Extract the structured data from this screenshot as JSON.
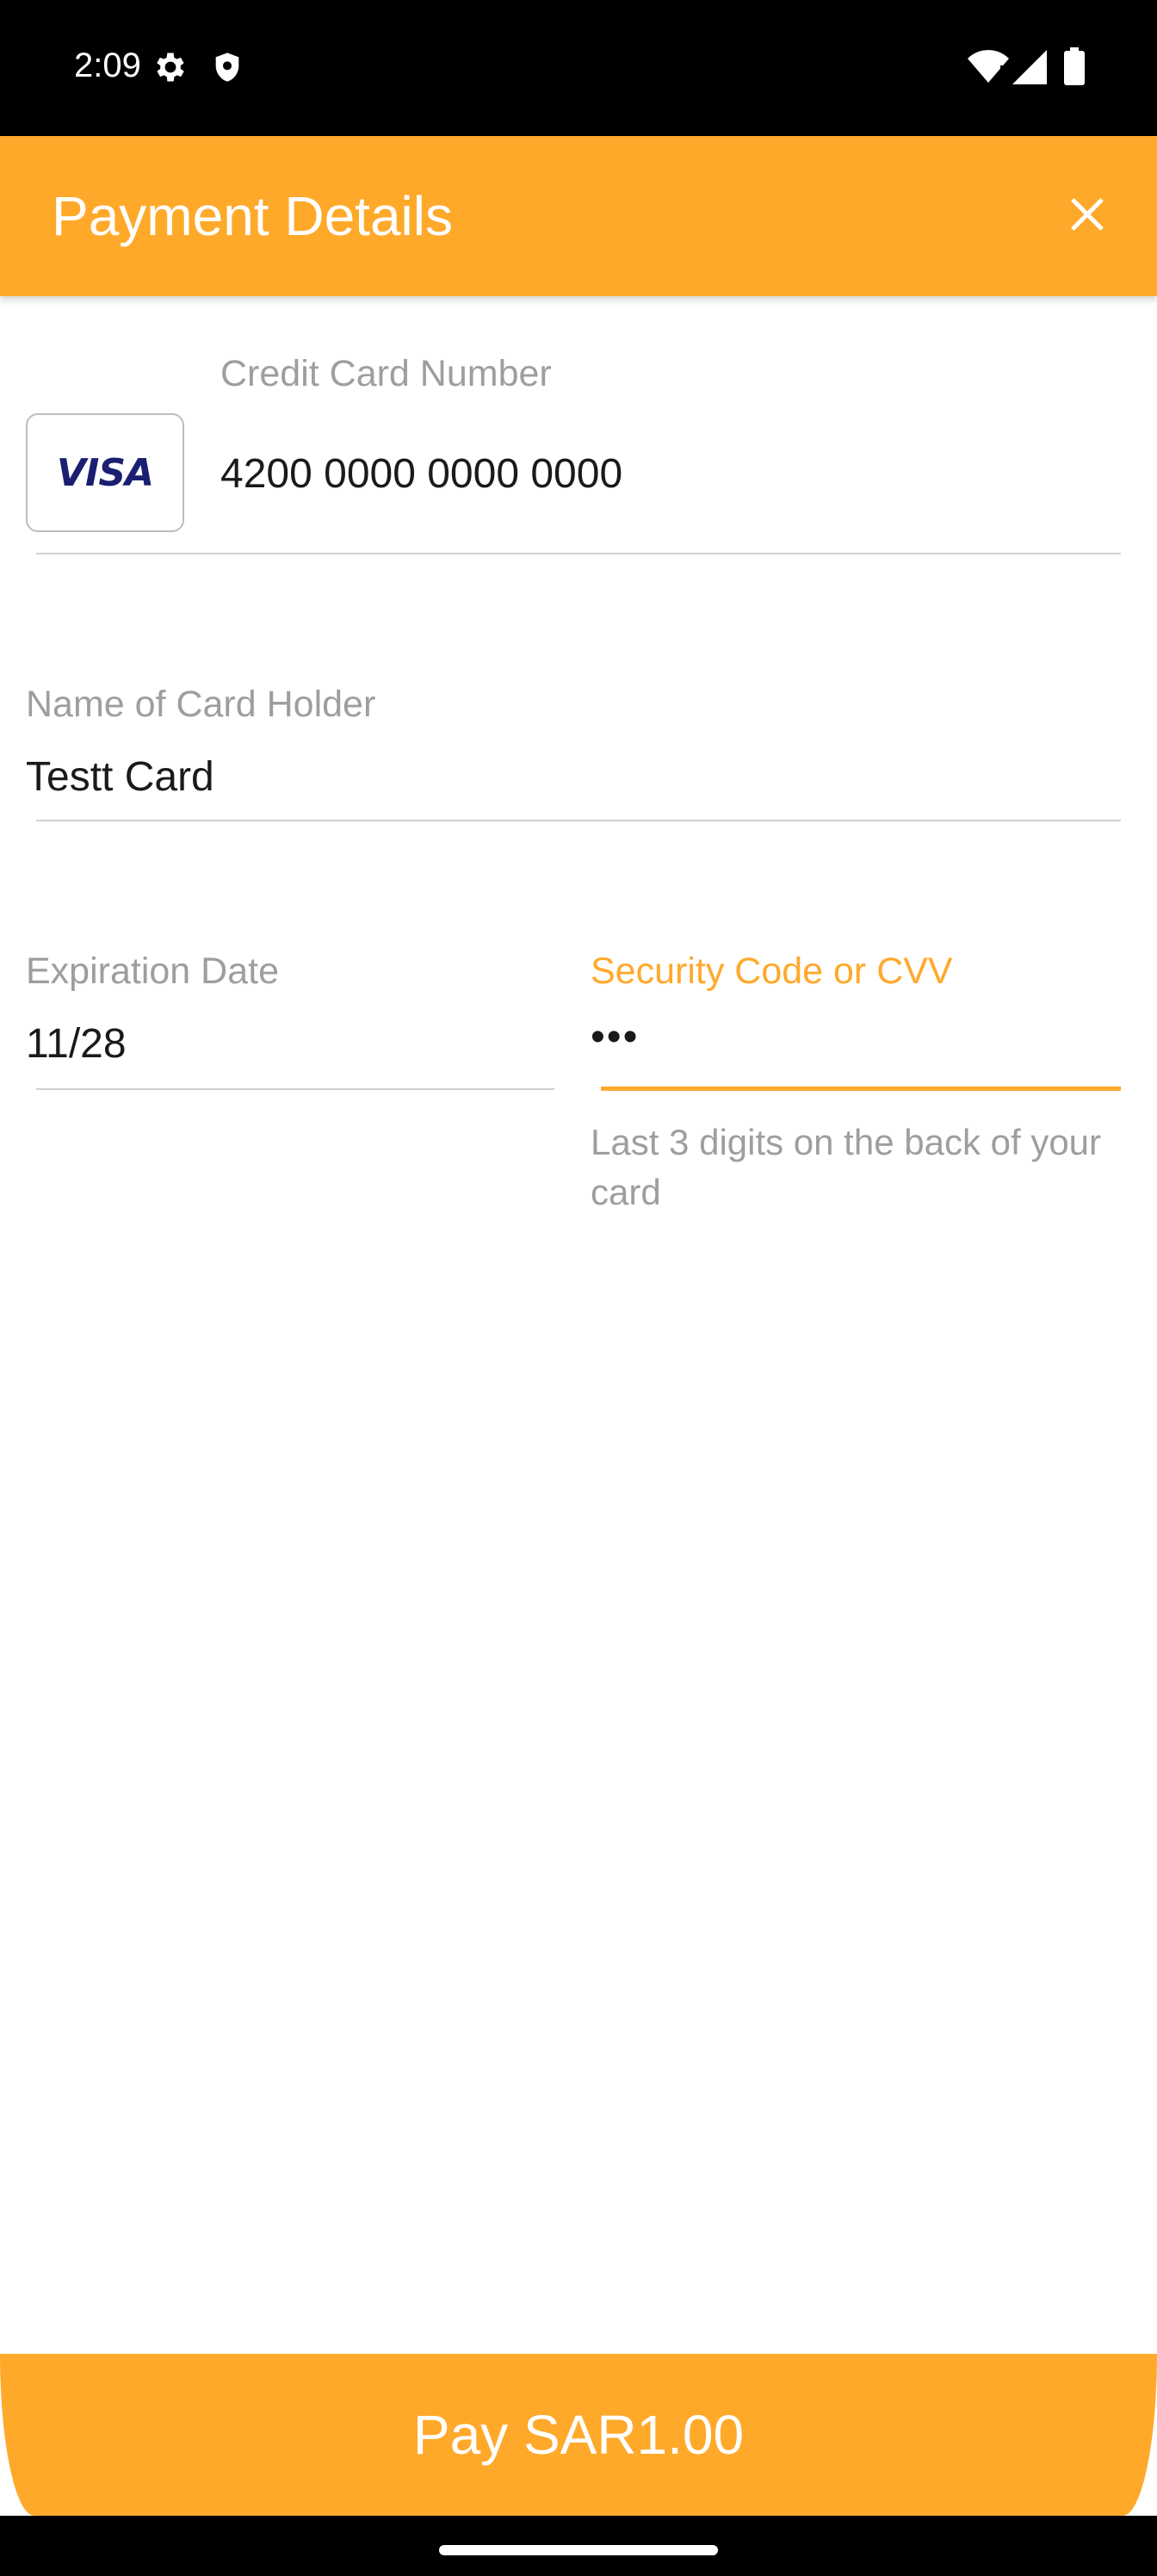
{
  "status_bar": {
    "time": "2:09",
    "icons": [
      "settings-icon",
      "shield-icon",
      "wifi-icon",
      "signal-icon",
      "battery-icon"
    ]
  },
  "app_bar": {
    "title": "Payment Details",
    "close_icon": "close-icon"
  },
  "card_number": {
    "label": "Credit Card Number",
    "value": "4200 0000 0000 0000",
    "brand": "VISA"
  },
  "card_holder": {
    "label": "Name of Card Holder",
    "value": "Testt Card"
  },
  "expiration": {
    "label": "Expiration Date",
    "value": "11/28"
  },
  "cvv": {
    "label": "Security Code or CVV",
    "value": "•••",
    "helper": "Last 3 digits on the back of your card"
  },
  "pay_button": {
    "label": "Pay SAR1.00"
  },
  "colors": {
    "accent": "#FFA92B",
    "label_gray": "#9E9E9E",
    "visa_blue": "#1A1F71"
  }
}
